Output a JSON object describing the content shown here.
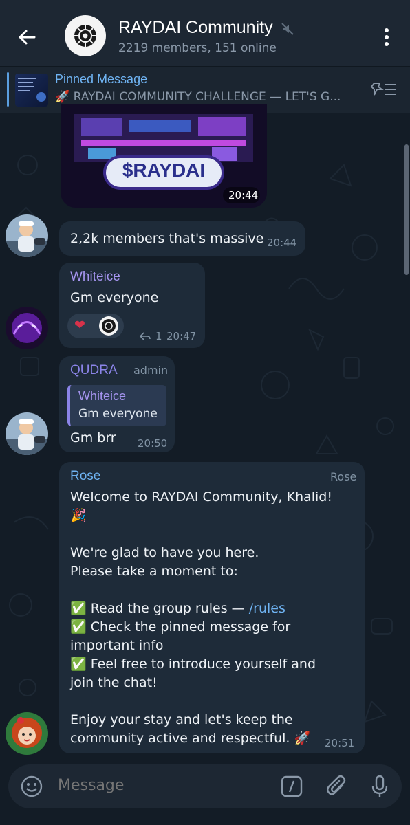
{
  "header": {
    "title": "RAYDAI Community",
    "subtitle": "2219 members, 151 online",
    "back_icon": "arrow-left-icon",
    "menu_icon": "more-vertical-icon"
  },
  "pinned": {
    "title": "Pinned Message",
    "text": "🚀 RAYDAI COMMUNITY CHALLENGE — LET'S G..."
  },
  "messages": {
    "image_msg": {
      "banner": "$RAYDAI",
      "time": "20:44"
    },
    "m1": {
      "text": "2,2k members that's massive",
      "time": "20:44"
    },
    "m2": {
      "sender": "Whiteice",
      "text": "Gm everyone",
      "reaction_count": "1",
      "time": "20:47"
    },
    "m3": {
      "sender": "QUDRA",
      "role": "admin",
      "quote_sender": "Whiteice",
      "quote_text": "Gm everyone",
      "text": "Gm brr",
      "time": "20:50"
    },
    "m4": {
      "sender": "Rose",
      "tag": "Rose",
      "l1": "Welcome to RAYDAI Community, Khalid!",
      "l2": "🎉",
      "l3": "We're glad to have you here.",
      "l4": "Please take a moment to:",
      "l5a": "✅ Read the group rules — ",
      "l5b": "/rules",
      "l6": "✅ Check the pinned message for",
      "l7": "important info",
      "l8": "✅ Feel free to introduce yourself and",
      "l9": "join the chat!",
      "l10": "Enjoy your stay and let's keep the",
      "l11": "community active and respectful. 🚀",
      "time": "20:51"
    }
  },
  "input": {
    "placeholder": "Message"
  },
  "colors": {
    "accent": "#6fb3f2",
    "whiteice_name": "#a695f0",
    "qudra_name": "#8b84e8",
    "rose_name": "#6fb3f2",
    "bubble": "#1e2b39"
  }
}
